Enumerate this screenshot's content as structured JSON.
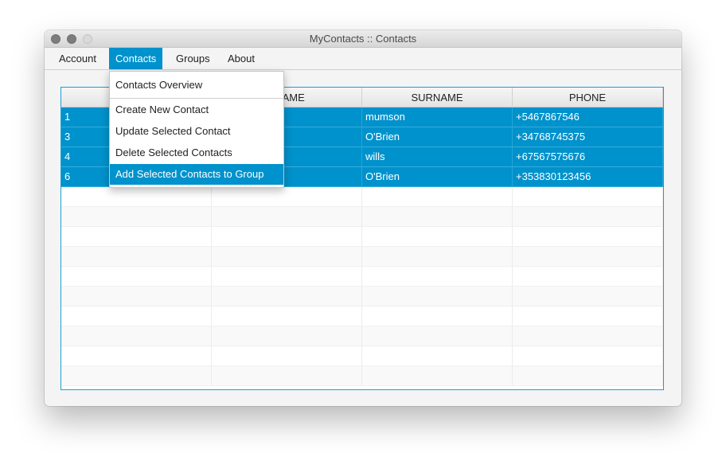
{
  "window": {
    "title": "MyContacts :: Contacts"
  },
  "menubar": {
    "items": [
      {
        "label": "Account"
      },
      {
        "label": "Contacts",
        "active": true
      },
      {
        "label": "Groups"
      },
      {
        "label": "About"
      }
    ]
  },
  "contacts_menu": {
    "items": [
      {
        "label": "Contacts Overview"
      },
      {
        "label": "Create New Contact"
      },
      {
        "label": "Update Selected Contact"
      },
      {
        "label": "Delete Selected Contacts"
      },
      {
        "label": "Add Selected Contacts to Group",
        "highlighted": true
      }
    ]
  },
  "table": {
    "columns": [
      "",
      "TNAME",
      "SURNAME",
      "PHONE"
    ],
    "rows": [
      {
        "id": "1",
        "firstname": "",
        "surname": "mumson",
        "phone": "+5467867546",
        "selected": true
      },
      {
        "id": "3",
        "firstname": "",
        "surname": "O'Brien",
        "phone": "+34768745375",
        "selected": true
      },
      {
        "id": "4",
        "firstname": "",
        "surname": "wills",
        "phone": "+67567575676",
        "selected": true
      },
      {
        "id": "6",
        "firstname": "",
        "surname": "O'Brien",
        "phone": "+353830123456",
        "selected": true
      }
    ]
  },
  "colors": {
    "accent": "#0092cc",
    "table_border": "#1a9fd4"
  }
}
